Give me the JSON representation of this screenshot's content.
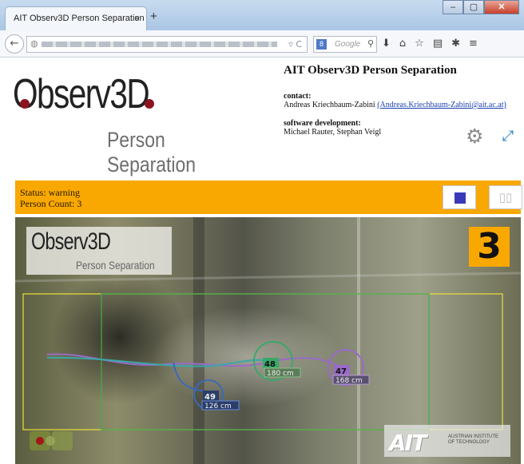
{
  "browser": {
    "tab_title": "AIT Observ3D Person Separation",
    "tab_close": "×",
    "new_tab": "+",
    "window_buttons": {
      "minimize": "‒",
      "maximize": "▢",
      "close": "✕"
    },
    "back_glyph": "←",
    "url_tail": "▿ C",
    "search_placeholder": "Google",
    "search_engine_letter": "8",
    "icons": [
      "download-icon",
      "home-icon",
      "bookmark-star-icon",
      "reading-list-icon",
      "extension-icon",
      "menu-icon"
    ],
    "icon_glyphs": [
      "⬇",
      "⌂",
      "☆",
      "▤",
      "✱",
      "≡"
    ]
  },
  "logo": {
    "word": "Observ3D",
    "subtitle": "Person Separation",
    "dot_color": "#8a1520"
  },
  "info": {
    "title": "AIT Observ3D Person Separation",
    "contact_label": "contact:",
    "contact_name": "Andreas Kriechbaum-Zabini",
    "contact_email": "(Andreas.Kriechbaum-Zabini@ait.ac.at)",
    "dev_label": "software development:",
    "dev_names": "Michael Rauter, Stephan Veigl"
  },
  "controls": {
    "settings_icon": "⚙",
    "fullscreen_icon": "⤢",
    "pause_glyph": "▯▯"
  },
  "status": {
    "status_line": "Status: warning",
    "count_line": "Person Count: 3",
    "bar_color": "#f8a800"
  },
  "feed": {
    "logo_word": "Observ3D",
    "logo_subtitle": "Person Separation",
    "person_count": "3",
    "tracks": [
      {
        "id": "48",
        "height": "180 cm",
        "color": "#3aa86a"
      },
      {
        "id": "47",
        "height": "168 cm",
        "color": "#9a6ac8"
      },
      {
        "id": "49",
        "height": "126 cm",
        "color": "#3a6ab8"
      }
    ],
    "ait_mark": "AIT",
    "ait_line1": "AUSTRIAN INSTITUTE",
    "ait_line2": "OF TECHNOLOGY"
  }
}
